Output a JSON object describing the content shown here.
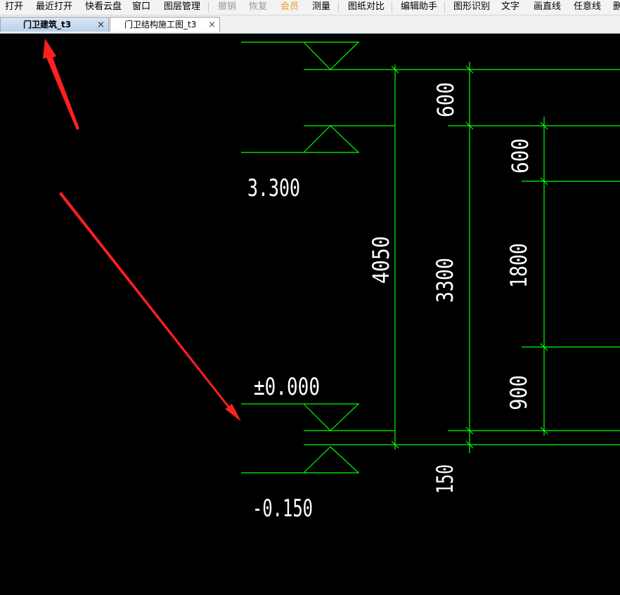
{
  "menu": {
    "items": [
      {
        "label": "打开",
        "state": "normal"
      },
      {
        "label": "最近打开",
        "state": "normal"
      },
      {
        "label": "快看云盘",
        "state": "normal"
      },
      {
        "label": "窗口",
        "state": "normal"
      },
      {
        "label": "图层管理",
        "state": "normal"
      },
      {
        "label": "撤销",
        "state": "disabled"
      },
      {
        "label": "恢复",
        "state": "disabled"
      },
      {
        "label": "会员",
        "state": "member"
      },
      {
        "label": "测量",
        "state": "normal"
      },
      {
        "label": "图纸对比",
        "state": "normal"
      },
      {
        "label": "编辑助手",
        "state": "normal"
      },
      {
        "label": "图形识别",
        "state": "normal"
      },
      {
        "label": "文字",
        "state": "normal"
      },
      {
        "label": "画直线",
        "state": "normal"
      },
      {
        "label": "任意线",
        "state": "normal"
      },
      {
        "label": "删",
        "state": "normal"
      }
    ]
  },
  "tabs": [
    {
      "label": "门卫建筑_t3",
      "active": true,
      "close": "×"
    },
    {
      "label": "门卫结构施工图_t3",
      "active": false,
      "close": "×"
    }
  ],
  "drawing": {
    "elevation_labels": {
      "top": "3.300",
      "middle": "±0.000",
      "bottom": "-0.150"
    },
    "dimensions": {
      "total": "4050",
      "storey": "3300",
      "top_a": "600",
      "top_b": "600",
      "window": "1800",
      "sill": "900",
      "base": "150"
    },
    "colors": {
      "background": "#000000",
      "lines": "#00ff00",
      "text": "#ffffff",
      "annotation_arrow": "#ff2020"
    }
  }
}
